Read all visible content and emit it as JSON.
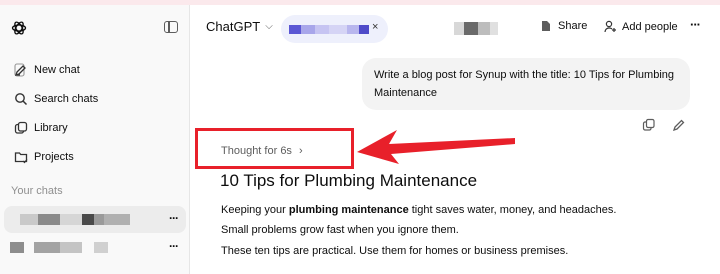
{
  "sidebar": {
    "items": [
      {
        "label": "New chat",
        "icon": "edit-icon"
      },
      {
        "label": "Search chats",
        "icon": "search-icon"
      },
      {
        "label": "Library",
        "icon": "library-icon"
      },
      {
        "label": "Projects",
        "icon": "folder-icon"
      }
    ],
    "section_title": "Your chats",
    "more": "···"
  },
  "header": {
    "model": "ChatGPT",
    "tab_close": "×",
    "share": "Share",
    "add_people": "Add people",
    "more": "···"
  },
  "conversation": {
    "user_message": "Write a blog post for Synup with the title: 10 Tips for Plumbing Maintenance",
    "thought": "Thought for 6s",
    "heading": "10 Tips for Plumbing Maintenance",
    "p1_before": "Keeping your ",
    "p1_bold": "plumbing maintenance",
    "p1_after": " tight saves water, money, and headaches.",
    "p2": "Small problems grow fast when you ignore them.",
    "p3": "These ten tips are practical. Use them for homes or business premises."
  },
  "colors": {
    "highlight": "#e8202a",
    "tab_bg": "#eef0fc",
    "sidebar_bg": "#f9f9f9"
  }
}
